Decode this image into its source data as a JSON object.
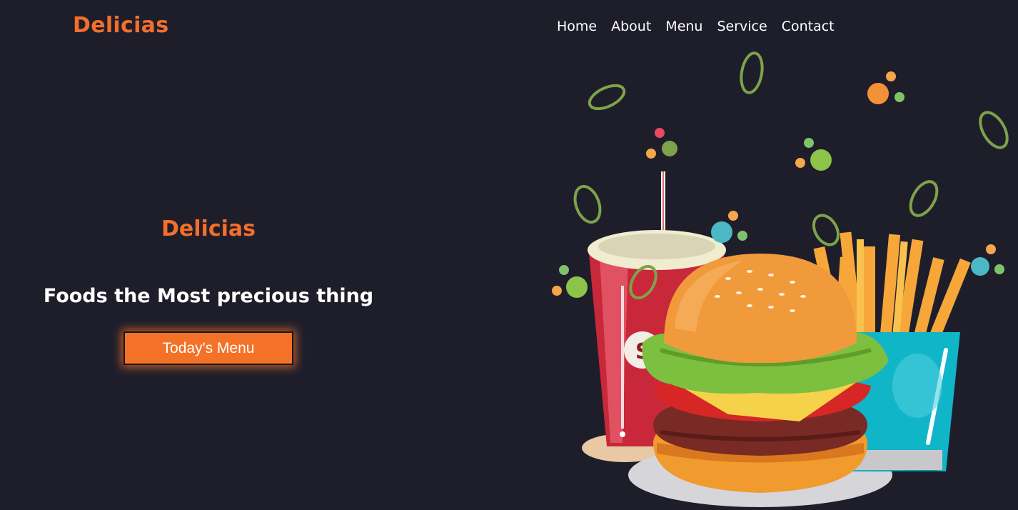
{
  "brand": {
    "logo_text": "Delicias"
  },
  "nav": {
    "items": [
      {
        "label": "Home"
      },
      {
        "label": "About"
      },
      {
        "label": "Menu"
      },
      {
        "label": "Service"
      },
      {
        "label": "Contact"
      }
    ]
  },
  "hero": {
    "title": "Delicias",
    "tagline": "Foods the Most precious thing",
    "cta_label": "Today's Menu"
  },
  "colors": {
    "background": "#1e1e2b",
    "accent": "#f36f2a",
    "text": "#ffffff",
    "leaf": "#7ea24a"
  },
  "illustration": {
    "icon": "burger-fries-soda-illustration"
  }
}
